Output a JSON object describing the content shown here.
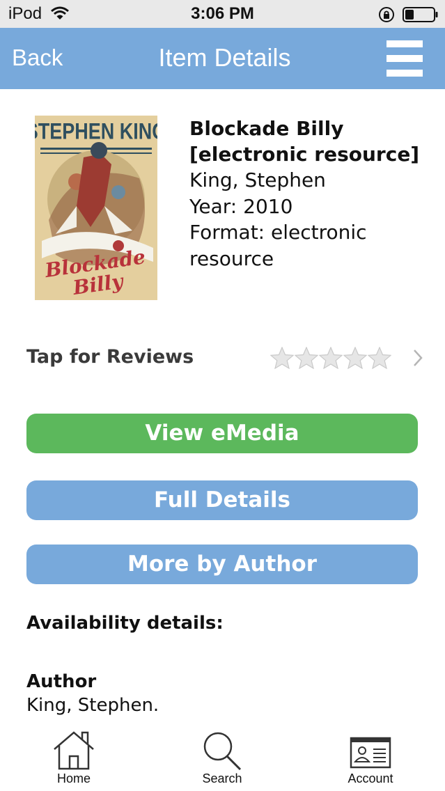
{
  "status_bar": {
    "carrier": "iPod",
    "time": "3:06 PM"
  },
  "nav": {
    "back_label": "Back",
    "title": "Item Details",
    "menu_icon": "hamburger-menu-icon"
  },
  "item": {
    "cover_image": "book-cover-blockade-billy",
    "title": "Blockade Billy [electronic resource]",
    "title_line1": "Blockade Billy",
    "title_line2": "[electronic resource]",
    "author": "King, Stephen",
    "year": "Year: 2010",
    "format_line1": "Format: electronic",
    "format_line2": "resource"
  },
  "reviews": {
    "label": "Tap for Reviews",
    "rating": 0,
    "max_rating": 5
  },
  "actions": {
    "view_emedia": "View eMedia",
    "full_details": "Full Details",
    "more_by_author": "More by Author"
  },
  "details": {
    "availability_label": "Availability details:",
    "author_heading": "Author",
    "author_value": "King, Stephen."
  },
  "tabs": [
    {
      "label": "Home",
      "icon": "home-icon"
    },
    {
      "label": "Search",
      "icon": "search-icon"
    },
    {
      "label": "Account",
      "icon": "account-card-icon"
    }
  ],
  "colors": {
    "nav_bar": "#78a9db",
    "primary_button": "#5cb85c",
    "secondary_button": "#78a9db",
    "status_bar": "#e9e9e9"
  }
}
